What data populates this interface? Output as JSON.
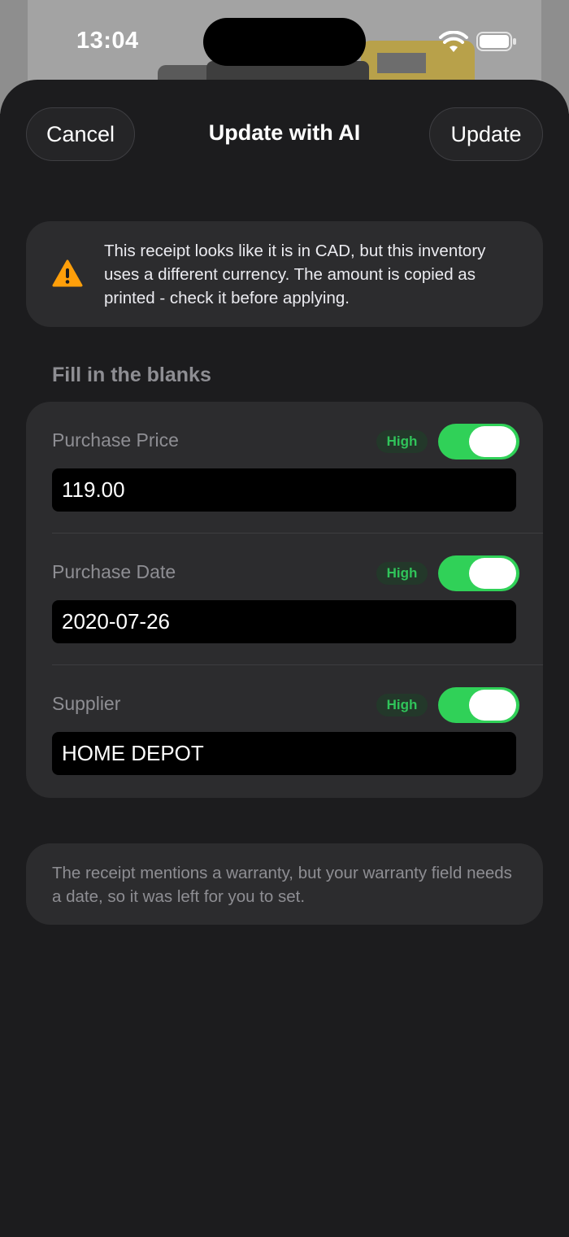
{
  "status_bar": {
    "time": "13:04"
  },
  "nav": {
    "cancel_label": "Cancel",
    "title": "Update with AI",
    "update_label": "Update"
  },
  "warning": {
    "icon": "warning-triangle-icon",
    "text": "This receipt looks like it is in CAD, but this inventory uses a different currency. The amount is copied as printed - check it before applying."
  },
  "section": {
    "header": "Fill in the blanks"
  },
  "fields": [
    {
      "label": "Purchase Price",
      "confidence": "High",
      "enabled": true,
      "value": "119.00"
    },
    {
      "label": "Purchase Date",
      "confidence": "High",
      "enabled": true,
      "value": "2020-07-26"
    },
    {
      "label": "Supplier",
      "confidence": "High",
      "enabled": true,
      "value": "HOME DEPOT"
    }
  ],
  "note": {
    "text": "The receipt mentions a warranty, but your warranty field needs a date, so it was left for you to set."
  },
  "colors": {
    "accent_green": "#30d158",
    "warning_orange": "#ff9f0a",
    "sheet_bg": "#1c1c1e",
    "card_bg": "#2c2c2e"
  }
}
